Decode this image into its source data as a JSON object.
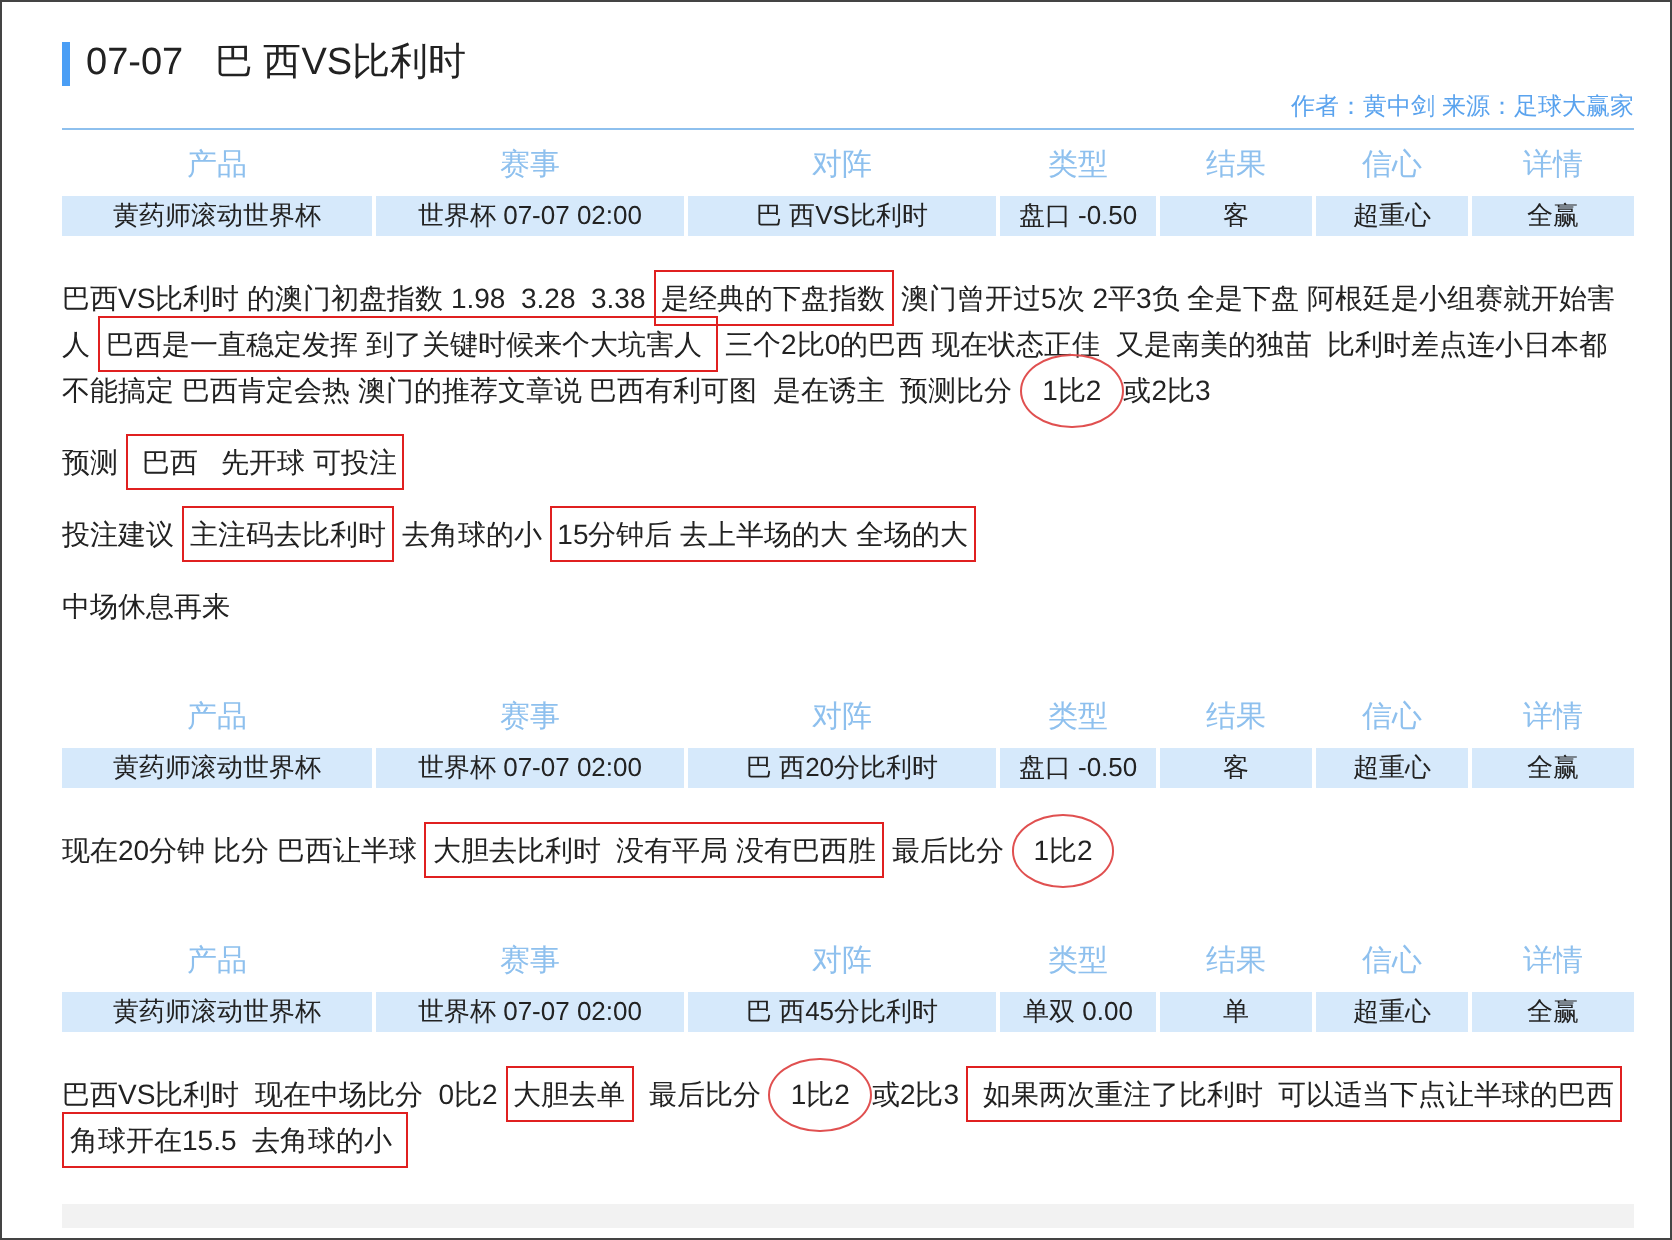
{
  "title": {
    "date": "07-07",
    "match": "巴 西VS比利时"
  },
  "byline": "作者：黄中剑 来源：足球大赢家",
  "sections": [
    {
      "columns": [
        "产品",
        "赛事",
        "对阵",
        "类型",
        "结果",
        "信心",
        "详情"
      ],
      "row": [
        "黄药师滚动世界杯",
        "世界杯 07-07 02:00",
        "巴 西VS比利时",
        "盘口 -0.50",
        "客",
        "超重心",
        "全赢"
      ],
      "paragraphs": [
        [
          {
            "kind": "plain",
            "text": "巴西VS比利时 的澳门初盘指数 1.98  3.28  3.38 "
          },
          {
            "kind": "boxed",
            "text": "是经典的下盘指数"
          },
          {
            "kind": "plain",
            "text": " 澳门曾开过5次 2平3负 全是下盘 阿根廷是小组赛就开始害"
          },
          {
            "kind": "plain",
            "text": "人 "
          },
          {
            "kind": "boxed",
            "text": "巴西是一直稳定发挥 到了关键时候来个大坑害人 "
          },
          {
            "kind": "plain",
            "text": " 三个2比0的巴西 现在状态正佳  又是南美的独苗  比利时差点连小日本都"
          },
          {
            "kind": "plain",
            "text": "不能搞定 巴西肯定会热 澳门的推荐文章说 巴西有利可图  是在诱主  预测比分 "
          },
          {
            "kind": "circled",
            "text": "1比2"
          },
          {
            "kind": "plain",
            "text": "或2比3"
          }
        ],
        [
          {
            "kind": "plain",
            "text": "预测 "
          },
          {
            "kind": "boxed",
            "text": " 巴西   先开球 可投注"
          }
        ],
        [
          {
            "kind": "plain",
            "text": "投注建议 "
          },
          {
            "kind": "boxed",
            "text": "主注码去比利时"
          },
          {
            "kind": "plain",
            "text": " 去角球的小 "
          },
          {
            "kind": "boxed",
            "text": "15分钟后 去上半场的大 全场的大"
          }
        ],
        [
          {
            "kind": "plain",
            "text": "中场休息再来"
          }
        ]
      ]
    },
    {
      "columns": [
        "产品",
        "赛事",
        "对阵",
        "类型",
        "结果",
        "信心",
        "详情"
      ],
      "row": [
        "黄药师滚动世界杯",
        "世界杯 07-07 02:00",
        "巴 西20分比利时",
        "盘口 -0.50",
        "客",
        "超重心",
        "全赢"
      ],
      "paragraphs": [
        [
          {
            "kind": "plain",
            "text": "现在20分钟 比分 巴西让半球 "
          },
          {
            "kind": "boxed",
            "text": "大胆去比利时  没有平局 没有巴西胜"
          },
          {
            "kind": "plain",
            "text": " 最后比分 "
          },
          {
            "kind": "circled",
            "text": "1比2"
          }
        ]
      ]
    },
    {
      "columns": [
        "产品",
        "赛事",
        "对阵",
        "类型",
        "结果",
        "信心",
        "详情"
      ],
      "row": [
        "黄药师滚动世界杯",
        "世界杯 07-07 02:00",
        "巴 西45分比利时",
        "单双 0.00",
        "单",
        "超重心",
        "全赢"
      ],
      "paragraphs": [
        [
          {
            "kind": "plain",
            "text": "巴西VS比利时  现在中场比分  0比2 "
          },
          {
            "kind": "boxed",
            "text": "大胆去单"
          },
          {
            "kind": "plain",
            "text": "  最后比分 "
          },
          {
            "kind": "circled",
            "text": "1比2"
          },
          {
            "kind": "plain",
            "text": "或2比3 "
          },
          {
            "kind": "boxed",
            "text": " 如果两次重注了比利时  可以适当下点让半球的巴西"
          },
          {
            "kind": "boxed",
            "text": "角球开在15.5  去角球的小 "
          }
        ]
      ]
    }
  ]
}
